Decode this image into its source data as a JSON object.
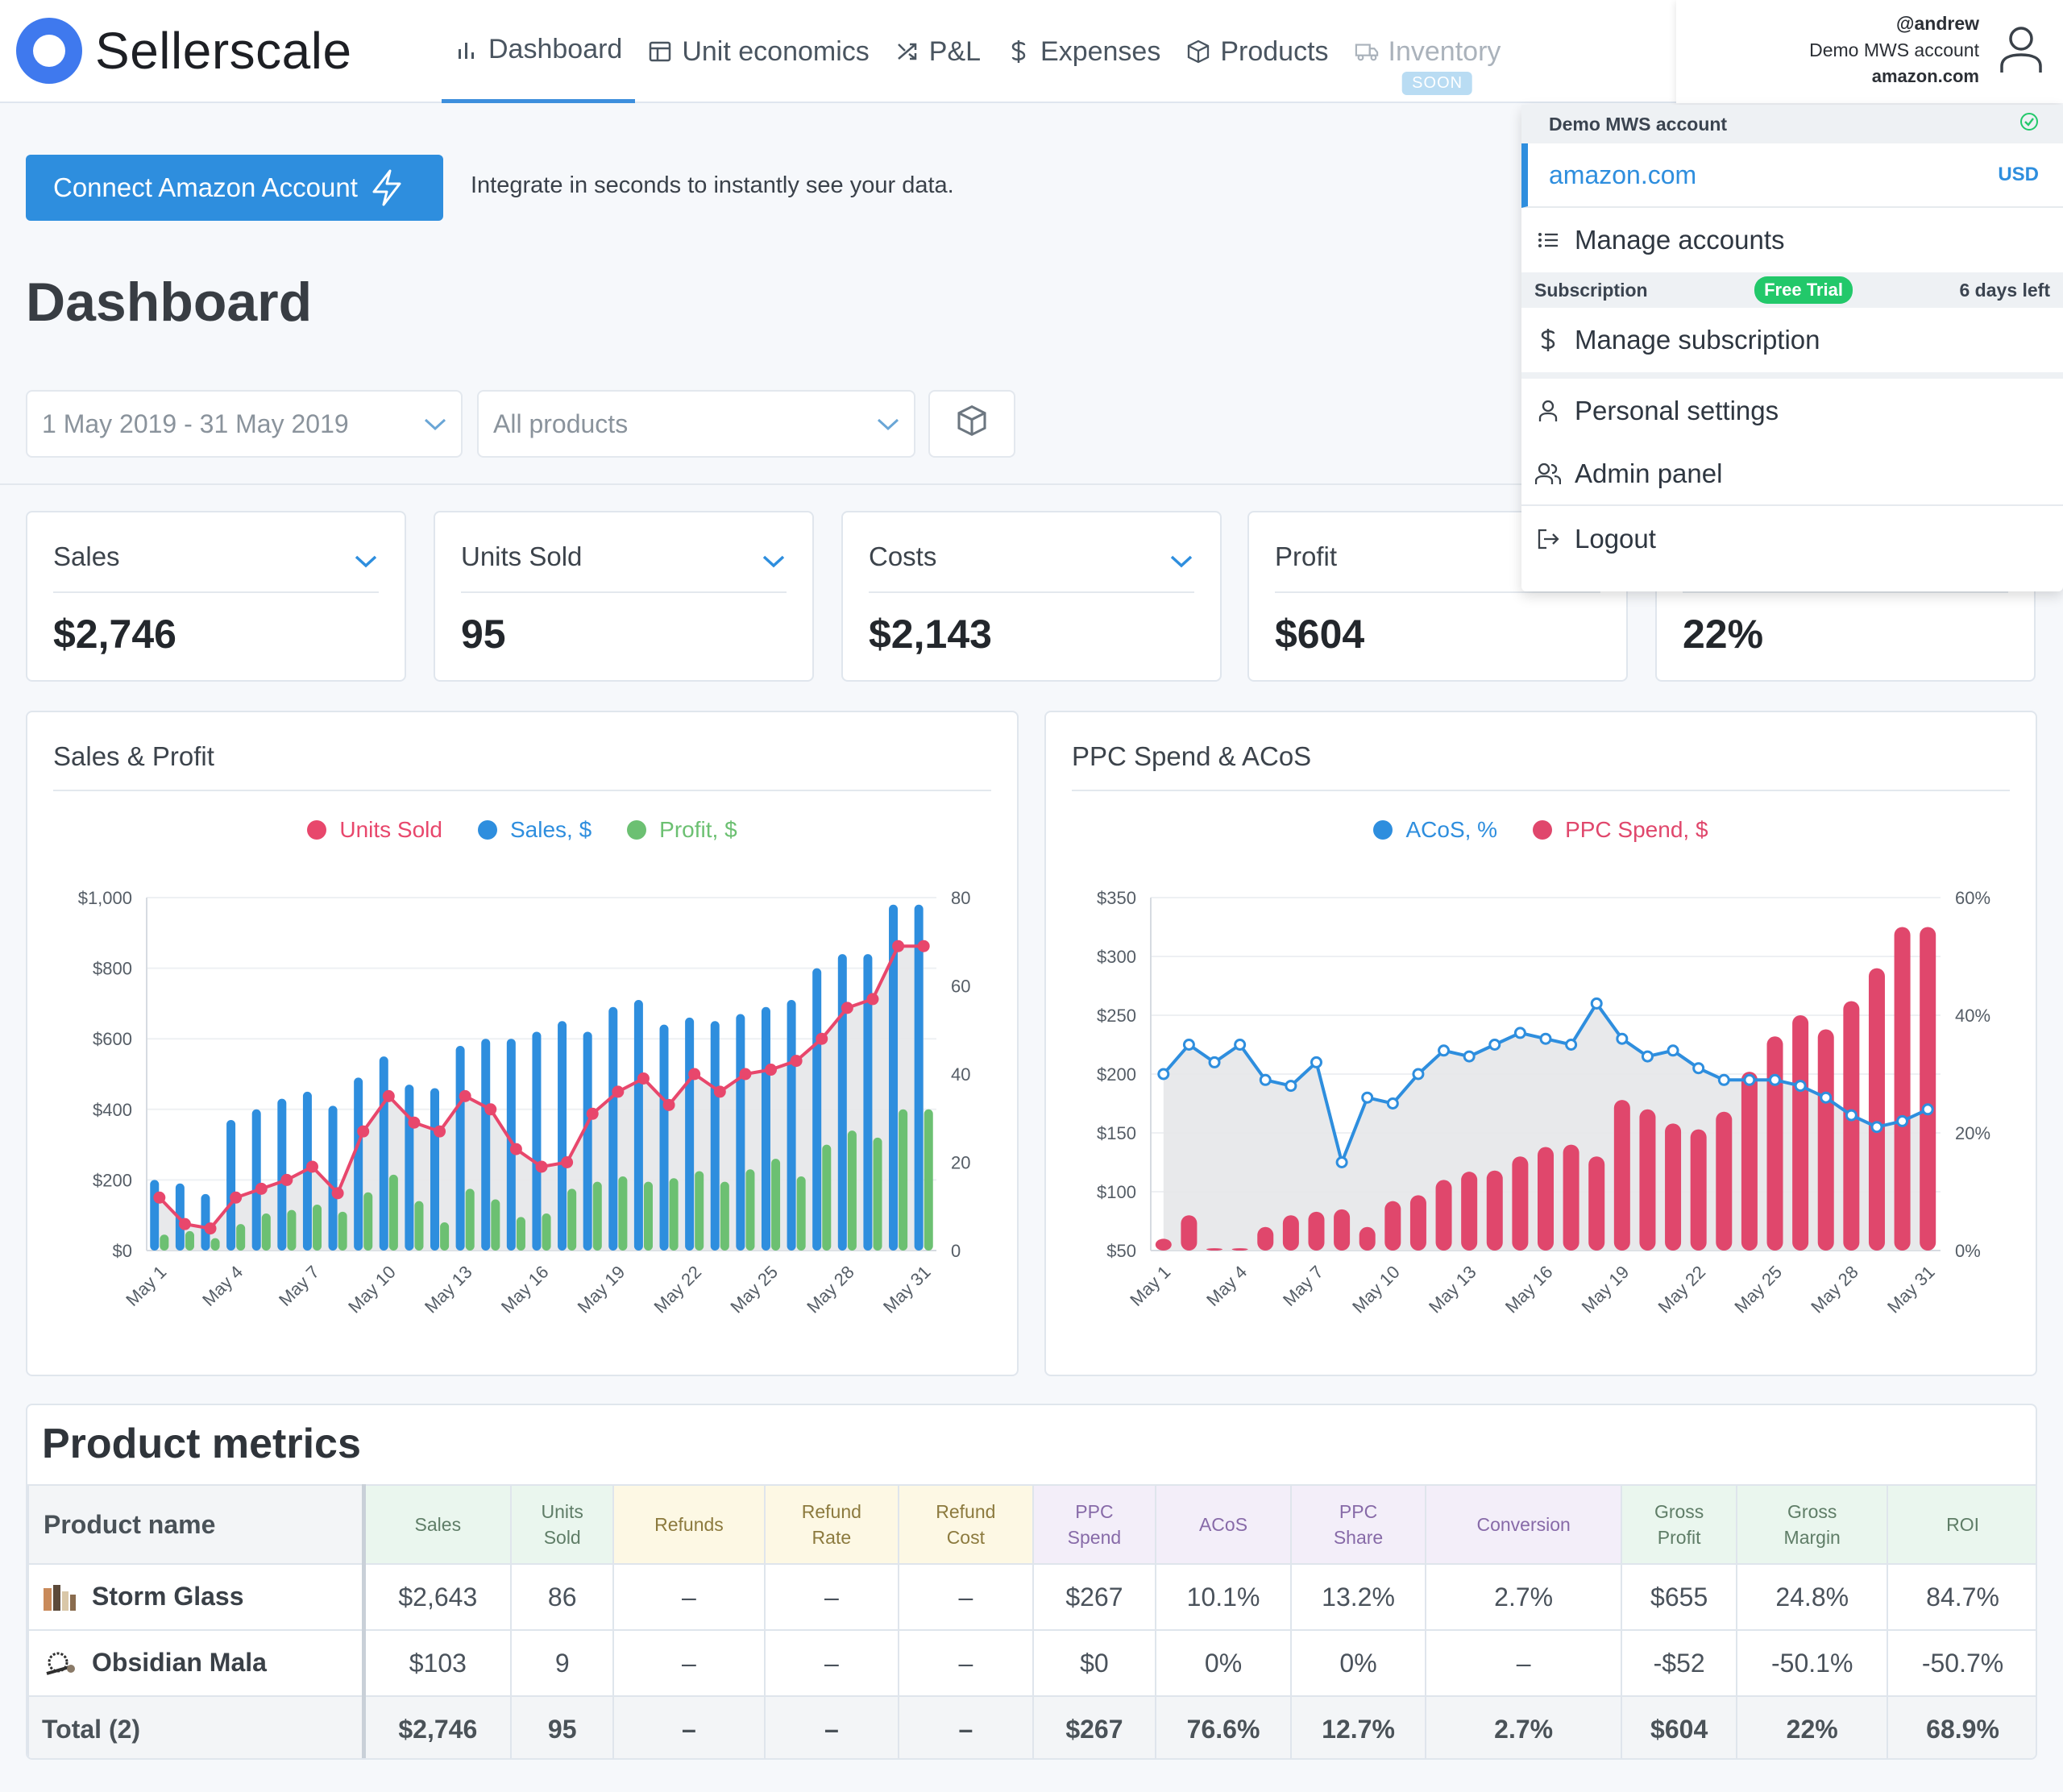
{
  "app": {
    "name": "Sellerscale"
  },
  "nav": {
    "items": [
      {
        "label": "Dashboard",
        "icon": "bar-chart-icon",
        "active": true
      },
      {
        "label": "Unit economics",
        "icon": "table-icon"
      },
      {
        "label": "P&L",
        "icon": "shuffle-icon"
      },
      {
        "label": "Expenses",
        "icon": "dollar-icon"
      },
      {
        "label": "Products",
        "icon": "box-icon"
      },
      {
        "label": "Inventory",
        "icon": "truck-icon",
        "disabled": true,
        "badge": "SOON"
      }
    ]
  },
  "user": {
    "handle": "@andrew",
    "account": "Demo MWS account",
    "marketplace": "amazon.com",
    "icon": "user-icon"
  },
  "menu": {
    "account_header": "Demo MWS account",
    "account_domain": "amazon.com",
    "currency": "USD",
    "manage_accounts": "Manage accounts",
    "subscription_label": "Subscription",
    "subscription_badge": "Free Trial",
    "days_left": "6 days left",
    "manage_subscription": "Manage subscription",
    "personal_settings": "Personal settings",
    "admin_panel": "Admin panel",
    "logout": "Logout"
  },
  "banner": {
    "button": "Connect Amazon Account",
    "text": "Integrate in seconds to instantly see your data."
  },
  "page": {
    "title": "Dashboard"
  },
  "filters": {
    "date_range": "1 May 2019 - 31 May 2019",
    "products": "All products"
  },
  "kpis": [
    {
      "label": "Sales",
      "value": "$2,746"
    },
    {
      "label": "Units Sold",
      "value": "95"
    },
    {
      "label": "Costs",
      "value": "$2,143"
    },
    {
      "label": "Profit",
      "value": "$604"
    },
    {
      "label": "",
      "value": "22%"
    }
  ],
  "colors": {
    "accent": "#2e8ede",
    "sales": "#2e8ede",
    "profit": "#6cc072",
    "units": "#e8476c",
    "ppc": "#e0476c",
    "acos": "#2e8ede"
  },
  "charts": {
    "sales_profit": {
      "title": "Sales & Profit"
    },
    "ppc": {
      "title": "PPC Spend & ACoS"
    }
  },
  "chart_data": [
    {
      "type": "bar",
      "title": "Sales & Profit",
      "categories": [
        "May 1",
        "May 2",
        "May 3",
        "May 4",
        "May 5",
        "May 6",
        "May 7",
        "May 8",
        "May 9",
        "May 10",
        "May 11",
        "May 12",
        "May 13",
        "May 14",
        "May 15",
        "May 16",
        "May 17",
        "May 18",
        "May 19",
        "May 20",
        "May 21",
        "May 22",
        "May 23",
        "May 24",
        "May 25",
        "May 26",
        "May 27",
        "May 28",
        "May 29",
        "May 30",
        "May 31"
      ],
      "tick_labels": [
        "May 1",
        "May 4",
        "May 7",
        "May 10",
        "May 13",
        "May 16",
        "May 19",
        "May 22",
        "May 25",
        "May 28",
        "May 31"
      ],
      "series": [
        {
          "name": "Units Sold",
          "type": "line",
          "axis": "right",
          "values": [
            12,
            6,
            5,
            12,
            14,
            16,
            19,
            13,
            27,
            35,
            29,
            27,
            35,
            32,
            23,
            19,
            20,
            31,
            36,
            39,
            33,
            40,
            36,
            40,
            41,
            43,
            48,
            55,
            57,
            69,
            69
          ]
        },
        {
          "name": "Sales, $",
          "type": "bar",
          "axis": "left",
          "values": [
            200,
            190,
            160,
            370,
            400,
            430,
            450,
            410,
            490,
            550,
            470,
            460,
            580,
            600,
            600,
            620,
            650,
            620,
            690,
            710,
            640,
            660,
            650,
            670,
            690,
            710,
            800,
            840,
            840,
            980,
            980
          ]
        },
        {
          "name": "Profit, $",
          "type": "bar",
          "axis": "left",
          "values": [
            45,
            55,
            35,
            75,
            105,
            115,
            130,
            110,
            165,
            215,
            140,
            80,
            175,
            145,
            95,
            105,
            175,
            195,
            210,
            195,
            205,
            225,
            195,
            230,
            260,
            210,
            300,
            340,
            320,
            400,
            400
          ]
        }
      ],
      "ylim_left": [
        0,
        1000
      ],
      "ylim_right": [
        0,
        80
      ],
      "yticks_left": [
        "$1,000",
        "$800",
        "$600",
        "$400",
        "$200",
        "$0"
      ],
      "yticks_right": [
        "80",
        "60",
        "40",
        "20",
        "0"
      ]
    },
    {
      "type": "bar",
      "title": "PPC Spend & ACoS",
      "categories": [
        "May 1",
        "May 2",
        "May 3",
        "May 4",
        "May 5",
        "May 6",
        "May 7",
        "May 8",
        "May 9",
        "May 10",
        "May 11",
        "May 12",
        "May 13",
        "May 14",
        "May 15",
        "May 16",
        "May 17",
        "May 18",
        "May 19",
        "May 20",
        "May 21",
        "May 22",
        "May 23",
        "May 24",
        "May 25",
        "May 26",
        "May 27",
        "May 28",
        "May 29",
        "May 30",
        "May 31"
      ],
      "tick_labels": [
        "May 1",
        "May 4",
        "May 7",
        "May 10",
        "May 13",
        "May 16",
        "May 19",
        "May 22",
        "May 25",
        "May 28",
        "May 31"
      ],
      "series": [
        {
          "name": "ACoS, %",
          "type": "line",
          "axis": "right",
          "values": [
            30,
            35,
            32,
            35,
            29,
            28,
            32,
            15,
            26,
            25,
            30,
            34,
            33,
            35,
            37,
            36,
            35,
            42,
            36,
            33,
            34,
            31,
            29,
            29,
            29,
            28,
            26,
            23,
            21,
            22,
            24
          ]
        },
        {
          "name": "PPC Spend, $",
          "type": "bar",
          "axis": "left",
          "values": [
            60,
            80,
            52,
            52,
            70,
            80,
            83,
            85,
            70,
            92,
            97,
            110,
            117,
            118,
            130,
            138,
            140,
            130,
            178,
            170,
            158,
            153,
            168,
            202,
            232,
            250,
            238,
            262,
            290,
            325,
            325
          ]
        }
      ],
      "ylim_left": [
        50,
        350
      ],
      "ylim_right": [
        0,
        60
      ],
      "yticks_left": [
        "$350",
        "$300",
        "$250",
        "$200",
        "$150",
        "$100",
        "$50"
      ],
      "yticks_right": [
        "60%",
        "40%",
        "20%",
        "0%"
      ]
    }
  ],
  "table": {
    "title": "Product metrics",
    "headers": [
      "Product name",
      "Sales",
      "Units\nSold",
      "Refunds",
      "Refund\nRate",
      "Refund\nCost",
      "PPC\nSpend",
      "ACoS",
      "PPC\nShare",
      "Conversion",
      "Gross\nProfit",
      "Gross\nMargin",
      "ROI"
    ],
    "rows": [
      {
        "name": "Storm Glass",
        "cells": [
          "$2,643",
          "86",
          "–",
          "–",
          "–",
          "$267",
          "10.1%",
          "13.2%",
          "2.7%",
          "$655",
          "24.8%",
          "84.7%"
        ]
      },
      {
        "name": "Obsidian Mala",
        "cells": [
          "$103",
          "9",
          "–",
          "–",
          "–",
          "$0",
          "0%",
          "0%",
          "–",
          "-$52",
          "-50.1%",
          "-50.7%"
        ]
      }
    ],
    "total": {
      "name": "Total (2)",
      "cells": [
        "$2,746",
        "95",
        "–",
        "–",
        "–",
        "$267",
        "76.6%",
        "12.7%",
        "2.7%",
        "$604",
        "22%",
        "68.9%"
      ]
    }
  }
}
